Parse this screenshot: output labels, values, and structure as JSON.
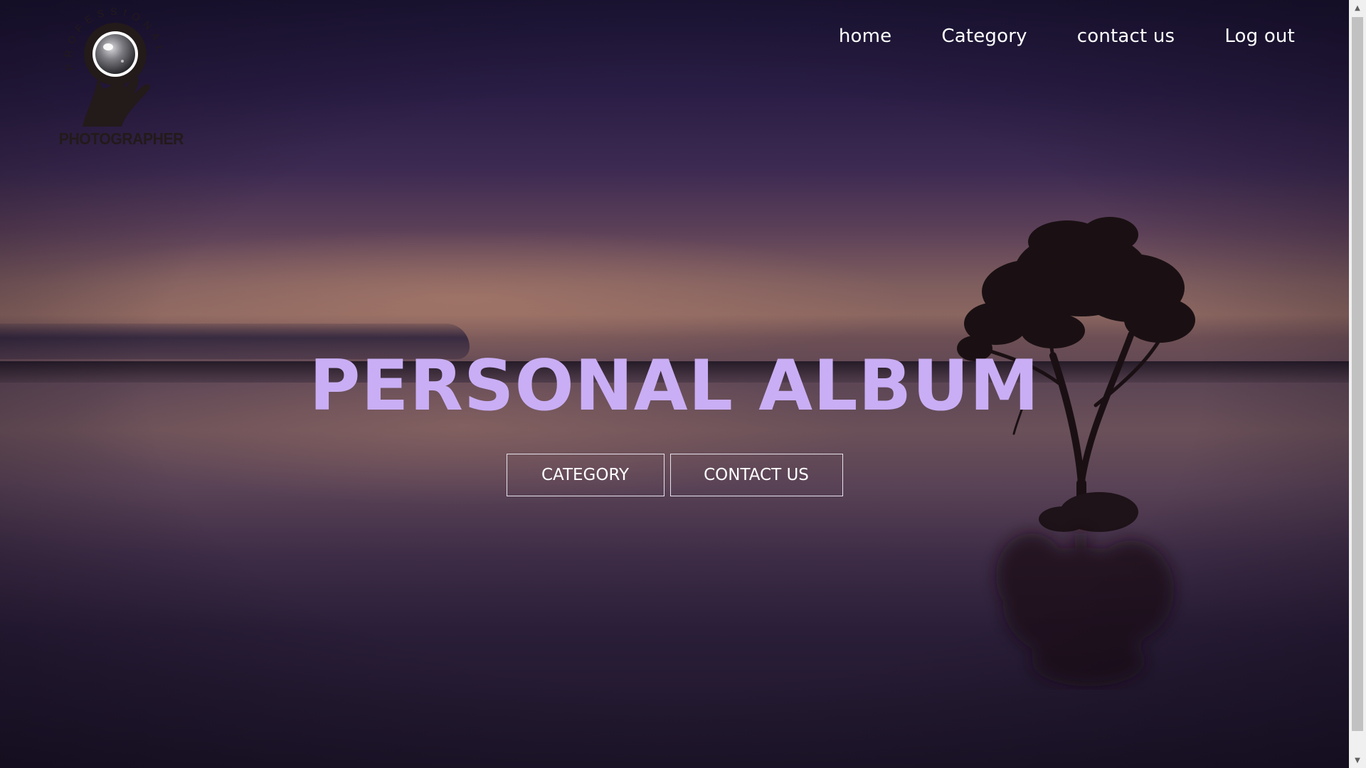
{
  "logo": {
    "arc_text": "PROFESSIONAL",
    "wordmark": "PHOTOGRAPHER",
    "icon": "camera-lens-hand-icon"
  },
  "nav": {
    "items": [
      {
        "label": "home"
      },
      {
        "label": "Category"
      },
      {
        "label": "contact us"
      },
      {
        "label": "Log out"
      }
    ]
  },
  "hero": {
    "title": "PERSONAL ALBUM",
    "buttons": {
      "category": "CATEGORY",
      "contact": "CONTACT US"
    }
  },
  "colors": {
    "title": "#c9aef5",
    "nav_text": "#ffffff",
    "button_border": "#e8e4ee",
    "logo": "#231a1a"
  },
  "scrollbar": {
    "up_icon": "triangle-up-icon",
    "down_icon": "triangle-down-icon"
  }
}
